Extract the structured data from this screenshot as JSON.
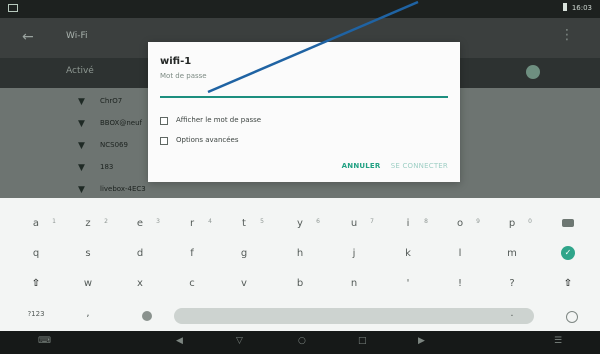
{
  "status_bar": {
    "time": "16:03",
    "left_icon": "notification-square-icon",
    "right_icon": "battery-icon"
  },
  "app_bar": {
    "title": "Wi-Fi",
    "back_icon": "back-arrow-icon",
    "more_icon": "more-icon"
  },
  "sub_bar": {
    "label": "Activé",
    "toggle_icon": "toggle-on-icon"
  },
  "networks": [
    {
      "name": "ChrO7",
      "icon": "wifi-icon"
    },
    {
      "name": "BBOX@neuf",
      "icon": "wifi-icon"
    },
    {
      "name": "NCS069",
      "icon": "wifi-icon"
    },
    {
      "name": "183",
      "icon": "wifi-icon"
    },
    {
      "name": "livebox-4EC3",
      "icon": "wifi-icon"
    }
  ],
  "dialog": {
    "title": "wifi-1",
    "password_label": "Mot de passe",
    "password_value": "",
    "show_password": "Afficher le mot de passe",
    "advanced_options": "Options avancées",
    "cancel": "ANNULER",
    "connect": "SE CONNECTER"
  },
  "keyboard": {
    "row1": [
      {
        "key": "a",
        "num": "1"
      },
      {
        "key": "z",
        "num": "2"
      },
      {
        "key": "e",
        "num": "3"
      },
      {
        "key": "r",
        "num": "4"
      },
      {
        "key": "t",
        "num": "5"
      },
      {
        "key": "y",
        "num": "6"
      },
      {
        "key": "u",
        "num": "7"
      },
      {
        "key": "i",
        "num": "8"
      },
      {
        "key": "o",
        "num": "9"
      },
      {
        "key": "p",
        "num": "0"
      }
    ],
    "row2": [
      "q",
      "s",
      "d",
      "f",
      "g",
      "h",
      "j",
      "k",
      "l",
      "m"
    ],
    "row3": [
      "w",
      "x",
      "c",
      "v",
      "b",
      "n",
      "'",
      "!",
      "?"
    ],
    "symbols_key": "?123",
    "comma_key": ",",
    "period_key": ".",
    "shift_icon": "shift-icon",
    "backspace_icon": "backspace-icon",
    "enter_icon": "enter-icon",
    "emoji_icon": "emoji-icon",
    "mic_icon": "mic-icon"
  },
  "nav_bar": {
    "icons": [
      "keyboard-hide-icon",
      "volume-down-icon",
      "back-icon",
      "home-icon",
      "recents-icon",
      "volume-up-icon",
      "menu-icon"
    ]
  },
  "colors": {
    "accent": "#22a183",
    "pointer_line": "#1f63a3"
  }
}
